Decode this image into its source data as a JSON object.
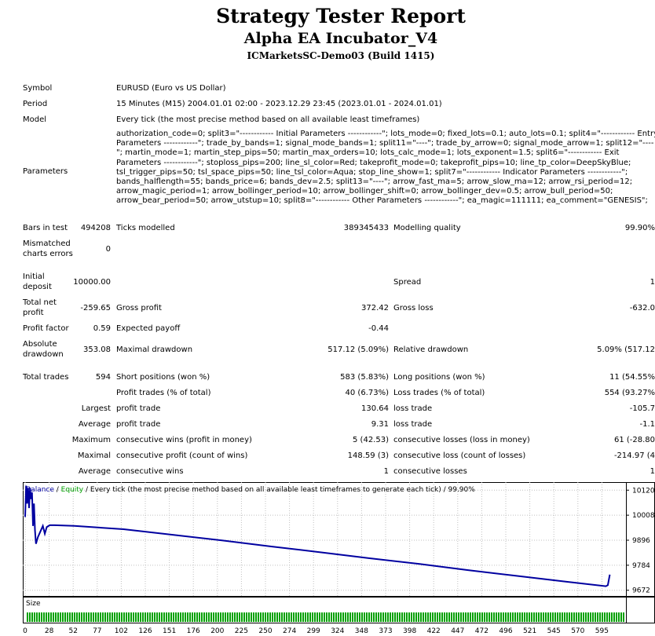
{
  "header": {
    "title": "Strategy Tester Report",
    "ea_name": "Alpha EA Incubator_V4",
    "server": "ICMarketsSC-Demo03 (Build 1415)"
  },
  "info": {
    "symbol_label": "Symbol",
    "symbol": "EURUSD (Euro vs US Dollar)",
    "period_label": "Period",
    "period": "15 Minutes (M15) 2004.01.01 02:00 - 2023.12.29 23:45 (2023.01.01 - 2024.01.01)",
    "model_label": "Model",
    "model": "Every tick (the most precise method based on all available least timeframes)",
    "parameters_label": "Parameters",
    "parameters": "authorization_code=0; split3=\"------------ Initial Parameters ------------\"; lots_mode=0; fixed_lots=0.1; auto_lots=0.1; split4=\"------------ Entry Parameters ------------\"; trade_by_bands=1; signal_mode_bands=1; split11=\"----\"; trade_by_arrow=0; signal_mode_arrow=1; split12=\"----\"; martin_mode=1; martin_step_pips=50; martin_max_orders=10; lots_calc_mode=1; lots_exponent=1.5; split6=\"------------ Exit Parameters ------------\"; stoploss_pips=200; line_sl_color=Red; takeprofit_mode=0; takeprofit_pips=10; line_tp_color=DeepSkyBlue; tsl_trigger_pips=50; tsl_space_pips=50; line_tsl_color=Aqua; stop_line_show=1; split7=\"------------ Indicator Parameters ------------\"; bands_halflength=55; bands_price=6; bands_dev=2.5; split13=\"----\"; arrow_fast_ma=5; arrow_slow_ma=12; arrow_rsi_period=12; arrow_magic_period=1; arrow_bollinger_period=10; arrow_bollinger_shift=0; arrow_bollinger_dev=0.5; arrow_bull_period=50; arrow_bear_period=50; arrow_utstup=10; split8=\"------------ Other Parameters ------------\"; ea_magic=111111; ea_comment=\"GENESIS\";"
  },
  "stats": {
    "bars_label": "Bars in test",
    "bars": "494208",
    "ticks_label": "Ticks modelled",
    "ticks": "389345433",
    "quality_label": "Modelling quality",
    "quality": "99.90%",
    "mismatched_label": "Mismatched charts errors",
    "mismatched": "0",
    "deposit_label": "Initial deposit",
    "deposit": "10000.00",
    "spread_label": "Spread",
    "spread": "1",
    "netprofit_label": "Total net profit",
    "netprofit": "-259.65",
    "grossprofit_label": "Gross profit",
    "grossprofit": "372.42",
    "grossloss_label": "Gross loss",
    "grossloss": "-632.0",
    "pf_label": "Profit factor",
    "pf": "0.59",
    "payoff_label": "Expected payoff",
    "payoff": "-0.44",
    "absdd_label": "Absolute drawdown",
    "absdd": "353.08",
    "maxdd_label": "Maximal drawdown",
    "maxdd": "517.12 (5.09%)",
    "reldd_label": "Relative drawdown",
    "reldd": "5.09% (517.12",
    "trades_label": "Total trades",
    "trades": "594",
    "short_label": "Short positions (won %)",
    "short": "583 (5.83%)",
    "long_label": "Long positions (won %)",
    "long": "11 (54.55%",
    "ptrades_label": "Profit trades (% of total)",
    "ptrades": "40 (6.73%)",
    "ltrades_label": "Loss trades (% of total)",
    "ltrades": "554 (93.27%",
    "largest_label": "Largest",
    "lp_label": "profit trade",
    "lp": "130.64",
    "ll_label": "loss trade",
    "ll": "-105.7",
    "average_label": "Average",
    "ap_label": "profit trade",
    "ap": "9.31",
    "al_label": "loss trade",
    "al": "-1.1",
    "maximum_label": "Maximum",
    "mcw_label": "consecutive wins (profit in money)",
    "mcw": "5 (42.53)",
    "mcl_label": "consecutive losses (loss in money)",
    "mcl": "61 (-28.80",
    "maximal_label": "Maximal",
    "mcp_label": "consecutive profit (count of wins)",
    "mcp": "148.59 (3)",
    "mclc_label": "consecutive loss (count of losses)",
    "mclc": "-214.97 (4",
    "average2_label": "Average",
    "acw_label": "consecutive wins",
    "acw": "1",
    "acl_label": "consecutive losses",
    "acl": "1"
  },
  "chart": {
    "legend_balance": "Balance",
    "legend_sep1": " / ",
    "legend_equity": "Equity",
    "legend_rest": " / Every tick (the most precise method based on all available least timeframes to generate each tick) / 99.90%",
    "balance_color": "#0000a0",
    "equity_color": "#00a000",
    "grid_color": "#c0c0c0",
    "y_ticks": [
      "10120",
      "10008",
      "9896",
      "9784",
      "9672"
    ],
    "y_tick_values": [
      10120,
      10008,
      9896,
      9784,
      9672
    ],
    "y_range": [
      9650,
      10142
    ],
    "x_ticks": [
      "0",
      "28",
      "52",
      "77",
      "102",
      "126",
      "151",
      "176",
      "200",
      "225",
      "250",
      "274",
      "299",
      "324",
      "348",
      "373",
      "398",
      "422",
      "447",
      "472",
      "496",
      "521",
      "545",
      "570",
      "595"
    ],
    "size_label": "Size",
    "chart_data": {
      "type": "line",
      "xlim": [
        0,
        608
      ],
      "ylim": [
        9650,
        10142
      ],
      "series": [
        {
          "name": "Balance",
          "x": [
            0,
            1,
            2,
            3,
            4,
            5,
            6,
            7,
            8,
            9,
            10,
            11,
            13,
            15,
            18,
            20,
            22,
            25,
            30,
            50,
            100,
            150,
            200,
            250,
            300,
            350,
            400,
            450,
            500,
            550,
            590,
            592,
            594
          ],
          "y": [
            10000,
            10140,
            10060,
            10130,
            10040,
            10130,
            10080,
            10110,
            9960,
            10060,
            9940,
            9880,
            9910,
            9930,
            9960,
            9925,
            9955,
            9963,
            9963,
            9960,
            9945,
            9920,
            9895,
            9868,
            9842,
            9815,
            9790,
            9762,
            9736,
            9710,
            9690,
            9695,
            9742
          ]
        }
      ]
    }
  }
}
